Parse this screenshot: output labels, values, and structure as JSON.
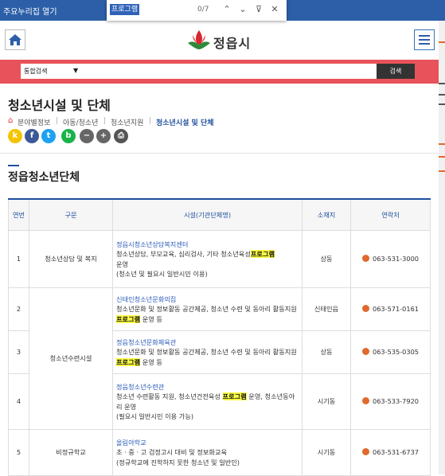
{
  "skip_link": "주요누리집 열기",
  "find": {
    "query": "프로그램",
    "count": "0/7",
    "prev_icon": "⌃",
    "next_icon": "⌄",
    "filter_icon": "⊽",
    "close_icon": "✕"
  },
  "header": {
    "logo_text": "정읍시",
    "home_icon": "home-icon",
    "menu_icon": "hamburger-icon"
  },
  "search": {
    "scope": "통합검색",
    "button": "검색"
  },
  "page_title": "청소년시설 및 단체",
  "breadcrumb": [
    "분야별정보",
    "아동/청소년",
    "청소년지원",
    "청소년시설 및 단체"
  ],
  "share_buttons": [
    {
      "label": "k",
      "color": "#f5c400"
    },
    {
      "label": "f",
      "color": "#3b5998"
    },
    {
      "label": "t",
      "color": "#1da1f2"
    },
    {
      "label": "b",
      "color": "#19b34a"
    },
    {
      "label": "−",
      "color": "#666666"
    },
    {
      "label": "+",
      "color": "#666666"
    },
    {
      "label": "⎙",
      "color": "#555555"
    }
  ],
  "section_title": "정읍청소년단체",
  "table": {
    "headers": [
      "연번",
      "구문",
      "시설(기관단체명)",
      "소재지",
      "연락처"
    ],
    "rows": [
      {
        "no": "1",
        "category": "청소년상담 및 복지",
        "name": "정읍시청소년상담복지센터",
        "desc_a": "청소년상담, 부모교육, 심리검사, 기타 청소년육성",
        "hl": "프로그램",
        "desc_b": " 운영",
        "desc_c": "(청소년 및 필요시 일반시민 이용)",
        "location": "상동",
        "phone": "063-531-3000"
      },
      {
        "no": "2",
        "category": "청소년수련시설",
        "name": "신태인청소년문화의집",
        "desc_a": "청소년문화 및 정보활동 공간제공, 청소년 수련 및 동아리 활동지원 ",
        "hl": "프로그램",
        "desc_b": " 운영 등",
        "location": "신태인읍",
        "phone": "063-571-0161"
      },
      {
        "no": "3",
        "name": "정읍청소년문화체육관",
        "desc_a": "청소년문화 및 정보활동 공간제공, 청소년 수련 및 동아리 활동지원 ",
        "hl": "프로그램",
        "desc_b": " 운영 등",
        "location": "상동",
        "phone": "063-535-0305"
      },
      {
        "no": "4",
        "name": "정읍청소년수련관",
        "desc_a": "청소년 수련활동 지원, 청소년건전육성 ",
        "hl": "프로그램",
        "desc_b": " 운영, 청소년동아리 운영",
        "desc_c": "(필요시 일반시민 이용 가능)",
        "location": "시기동",
        "phone": "063-533-7920"
      },
      {
        "no": "5",
        "category": "비정규학교",
        "name": "올림야학교",
        "desc_a": "초 · 중 · 고 검정고시 대비 및 정보화교육",
        "desc_c": "(정규학교에 진학하지 못한 청소년 및 일반인)",
        "location": "시기동",
        "phone": "063-531-6737"
      }
    ]
  }
}
